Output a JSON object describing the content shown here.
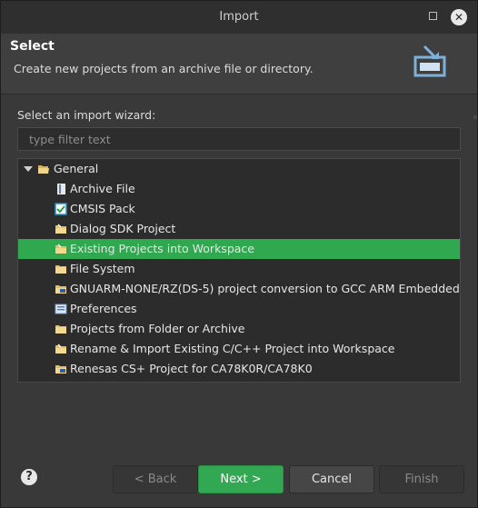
{
  "window": {
    "title": "Import"
  },
  "banner": {
    "title": "Select",
    "description": "Create new projects from an archive file or directory."
  },
  "wizard": {
    "label": "Select an import wizard:",
    "filter_placeholder": "type filter text",
    "tree": {
      "group_label": "General",
      "items": [
        {
          "label": "Archive File",
          "icon": "archive-icon"
        },
        {
          "label": "CMSIS Pack",
          "icon": "cmsis-pack-icon"
        },
        {
          "label": "Dialog SDK Project",
          "icon": "folder-import-icon"
        },
        {
          "label": "Existing Projects into Workspace",
          "icon": "folder-import-icon",
          "selected": true
        },
        {
          "label": "File System",
          "icon": "folder-icon"
        },
        {
          "label": "GNUARM-NONE/RZ(DS-5)  project conversion to GCC ARM Embedded",
          "icon": "conversion-icon"
        },
        {
          "label": "Preferences",
          "icon": "preferences-icon"
        },
        {
          "label": "Projects from Folder or Archive",
          "icon": "folder-icon"
        },
        {
          "label": "Rename & Import Existing C/C++ Project into Workspace",
          "icon": "folder-import-icon"
        },
        {
          "label": "Renesas CS+ Project for CA78K0R/CA78K0",
          "icon": "renesas-project-icon"
        }
      ]
    }
  },
  "buttons": {
    "back": "< Back",
    "next": "Next >",
    "cancel": "Cancel",
    "finish": "Finish"
  },
  "colors": {
    "selection": "#2fa84f",
    "primary": "#33a852",
    "background": "#393939"
  }
}
